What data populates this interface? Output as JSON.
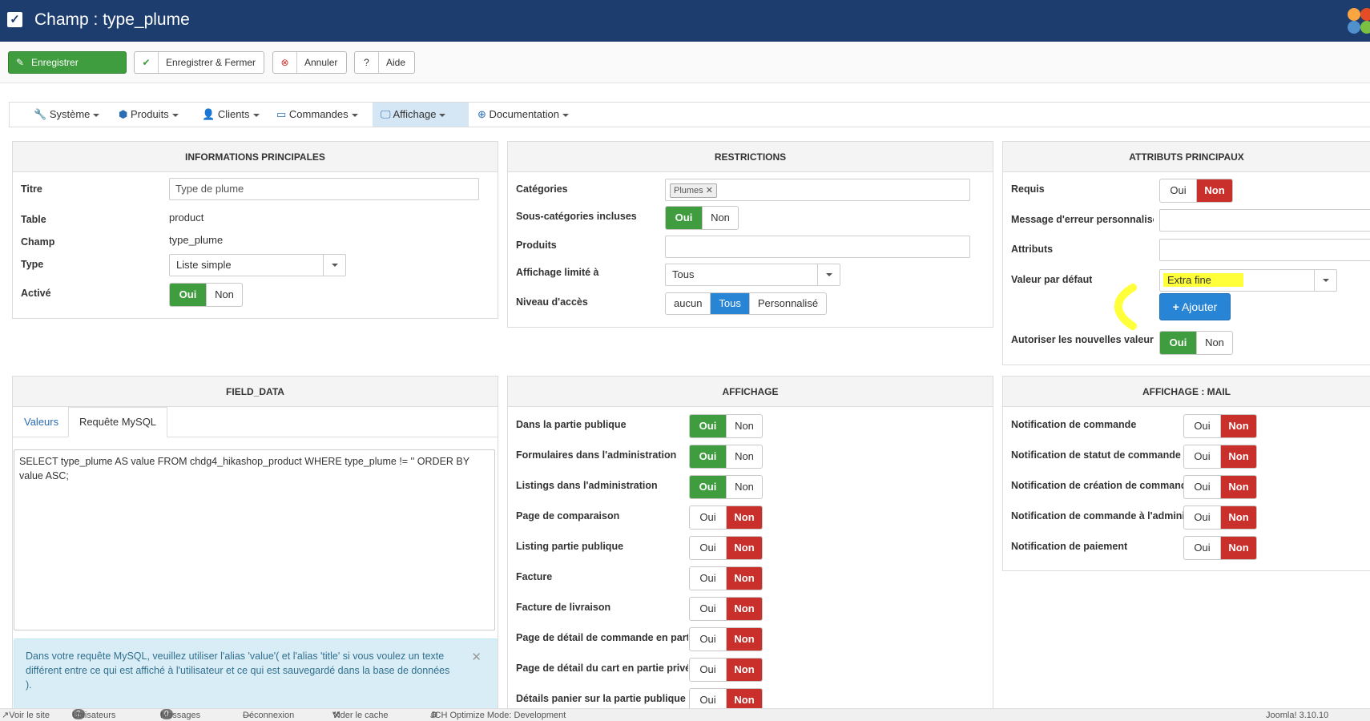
{
  "header": {
    "title": "Champ : type_plume"
  },
  "toolbar": {
    "save": "Enregistrer",
    "save_close": "Enregistrer & Fermer",
    "cancel": "Annuler",
    "help": "Aide"
  },
  "menu": [
    {
      "label": "Système",
      "icon": "wrench-icon"
    },
    {
      "label": "Produits",
      "icon": "cubes-icon"
    },
    {
      "label": "Clients",
      "icon": "user-icon"
    },
    {
      "label": "Commandes",
      "icon": "credit-card-icon"
    },
    {
      "label": "Affichage",
      "icon": "monitor-icon"
    },
    {
      "label": "Documentation",
      "icon": "lifebuoy-icon"
    }
  ],
  "info": {
    "heading": "INFORMATIONS PRINCIPALES",
    "titre_label": "Titre",
    "titre_value": "Type de plume",
    "table_label": "Table",
    "table_value": "product",
    "champ_label": "Champ",
    "champ_value": "type_plume",
    "type_label": "Type",
    "type_value": "Liste simple",
    "active_label": "Activé"
  },
  "restrictions": {
    "heading": "RESTRICTIONS",
    "categories_label": "Catégories",
    "categories_tag": "Plumes",
    "subcats_label": "Sous-catégories incluses",
    "produits_label": "Produits",
    "affichage_label": "Affichage limité à",
    "affichage_value": "Tous",
    "niveau_label": "Niveau d'accès",
    "niveau_options": [
      "aucun",
      "Tous",
      "Personnalisé"
    ]
  },
  "attributs": {
    "heading": "ATTRIBUTS PRINCIPAUX",
    "requis_label": "Requis",
    "message_label": "Message d'erreur personnalisé",
    "attributs_label": "Attributs",
    "defaut_label": "Valeur par défaut",
    "defaut_value": "Extra fine",
    "ajouter": "Ajouter",
    "nouvelles_label": "Autoriser les nouvelles valeurs"
  },
  "field_data": {
    "heading": "FIELD_DATA",
    "tab_valeurs": "Valeurs",
    "tab_requete": "Requête MySQL",
    "query": "SELECT type_plume AS value FROM chdg4_hikashop_product WHERE type_plume != '' ORDER BY value ASC;",
    "info": "Dans votre requête MySQL, veuillez utiliser l'alias 'value'( et l'alias 'title' si vous voulez un texte différent entre ce qui est affiché à l'utilisateur et ce qui est sauvegardé dans la base de données )."
  },
  "affichage": {
    "heading": "AFFICHAGE",
    "rows": [
      {
        "label": "Dans la partie publique",
        "state": "oui"
      },
      {
        "label": "Formulaires dans l'administration",
        "state": "oui"
      },
      {
        "label": "Listings dans l'administration",
        "state": "oui"
      },
      {
        "label": "Page de comparaison",
        "state": "non"
      },
      {
        "label": "Listing partie publique",
        "state": "non"
      },
      {
        "label": "Facture",
        "state": "non"
      },
      {
        "label": "Facture de livraison",
        "state": "non"
      },
      {
        "label": "Page de détail de commande en partie privée",
        "state": "non"
      },
      {
        "label": "Page de détail du cart en partie privée",
        "state": "non"
      },
      {
        "label": "Détails panier sur la partie publique",
        "state": "non"
      }
    ]
  },
  "mail": {
    "heading": "AFFICHAGE : MAIL",
    "rows": [
      {
        "label": "Notification de commande",
        "state": "non"
      },
      {
        "label": "Notification de statut de commande",
        "state": "non"
      },
      {
        "label": "Notification de création de commande",
        "state": "non"
      },
      {
        "label": "Notification de commande à l'administrateur",
        "state": "non"
      },
      {
        "label": "Notification de paiement",
        "state": "non"
      }
    ]
  },
  "toggle": {
    "oui": "Oui",
    "non": "Non"
  },
  "footer": {
    "voir": "Voir le site",
    "users_count": "2",
    "users": "Utilisateurs",
    "msg_count": "0",
    "messages": "Messages",
    "logout": "Déconnexion",
    "cache": "Vider le cache",
    "jch": "JCH Optimize Mode: Development",
    "version": "Joomla! 3.10.10"
  },
  "colors": {
    "header": "#1c3d6e",
    "green": "#3f9c3f",
    "red": "#c9302c",
    "blue": "#2884d4",
    "highlight": "#ffff3a"
  }
}
